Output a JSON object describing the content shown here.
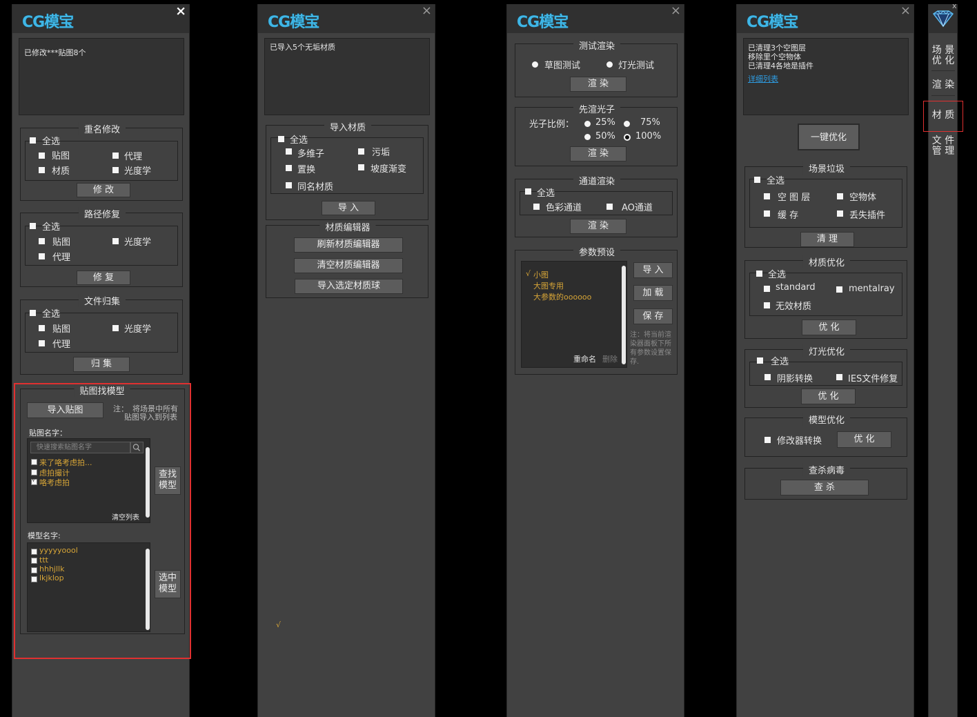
{
  "logo": "CG模宝",
  "close_glyph": "×",
  "p1": {
    "status": "已修改***贴图8个",
    "rename": {
      "title": "重名修改",
      "all": "全选",
      "map": "贴图",
      "proxy": "代理",
      "material": "材质",
      "photometric": "光度学",
      "button": "修 改"
    },
    "path": {
      "title": "路径修复",
      "all": "全选",
      "map": "贴图",
      "photometric": "光度学",
      "proxy": "代理",
      "button": "修 复"
    },
    "collect": {
      "title": "文件归集",
      "all": "全选",
      "map": "贴图",
      "photometric": "光度学",
      "proxy": "代理",
      "button": "归 集"
    },
    "find": {
      "title": "贴图找模型",
      "import_btn": "导入贴图",
      "note_a": "注：",
      "note_b": "将场景中所有",
      "note_c": "贴图导入到列表",
      "map_name_label": "贴图名字：",
      "search_placeholder": "快速搜索贴图名字",
      "maps": [
        {
          "name": "来了咯考虑拍...",
          "check": ""
        },
        {
          "name": "虑拍撮计",
          "check": ""
        },
        {
          "name": "咯考虑拍",
          "check": "√"
        }
      ],
      "clear_list": "清空列表",
      "find_model_btn": "查找\n模型",
      "model_name_label": "模型名字:",
      "models": [
        "yyyyyoool",
        "ttt",
        "hhhjllk",
        "lkjklop"
      ],
      "select_model_btn": "选中\n模型"
    }
  },
  "p2": {
    "status": "已导入5个无垢材质",
    "import": {
      "title": "导入材质",
      "all": "全选",
      "multi": "多维子",
      "dirt": "污垢",
      "displace": "置换",
      "falloff": "坡度渐变",
      "same": "同名材质",
      "button": "导 入"
    },
    "editor": {
      "title": "材质编辑器",
      "refresh": "刷新材质编辑器",
      "clear": "清空材质编辑器",
      "import_sel": "导入选定材质球"
    },
    "check_mark": "√"
  },
  "p3": {
    "test": {
      "title": "测试渲染",
      "draft": "草图测试",
      "light": "灯光测试",
      "button": "渲 染"
    },
    "photon": {
      "title": "先渲光子",
      "ratio_label": "光子比例：",
      "p25": "25%",
      "p75": "75%",
      "p50": "50%",
      "p100": "100%",
      "button": "渲 染"
    },
    "channel": {
      "title": "通道渲染",
      "all": "全选",
      "color": "色彩通道",
      "ao": "AO通道",
      "button": "渲 染"
    },
    "preset": {
      "title": "参数预设",
      "items": [
        {
          "mark": "√",
          "name": "小图"
        },
        {
          "mark": "",
          "name": "大图专用"
        },
        {
          "mark": "",
          "name": "大参数的oooooo"
        }
      ],
      "rename": "重命名",
      "delete": "删除",
      "import": "导 入",
      "load": "加 载",
      "save": "保 存",
      "note": "注：将当前渲染器面板下所有参数设置保存."
    }
  },
  "p4": {
    "status_lines": [
      "已清理3个空图层",
      "移除里个空物体",
      "已清理4各地是插件"
    ],
    "detail_link": "详细列表",
    "one_click": "一键优化",
    "trash": {
      "title": "场景垃圾",
      "all": "全选",
      "empty_layer": "空 图 层",
      "empty_obj": "空物体",
      "cache": "缓 存",
      "lost_plugin": "丢失插件",
      "button": "清 理"
    },
    "mat_opt": {
      "title": "材质优化",
      "all": "全选",
      "standard": "standard",
      "mentalray": "mentalray",
      "invalid": "无效材质",
      "button": "优 化"
    },
    "light_opt": {
      "title": "灯光优化",
      "all": "全选",
      "shadow": "阴影转换",
      "ies": "IES文件修复",
      "button": "优 化"
    },
    "model_opt": {
      "title": "模型优化",
      "modifier": "修改器转换",
      "button": "优 化"
    },
    "virus": {
      "title": "查杀病毒",
      "button": "查 杀"
    }
  },
  "side": {
    "close": "x",
    "items": [
      {
        "label": "场 景\n优 化"
      },
      {
        "label": "渲 染"
      },
      {
        "label": "材 质"
      },
      {
        "label": "文 件\n管 理"
      }
    ]
  }
}
